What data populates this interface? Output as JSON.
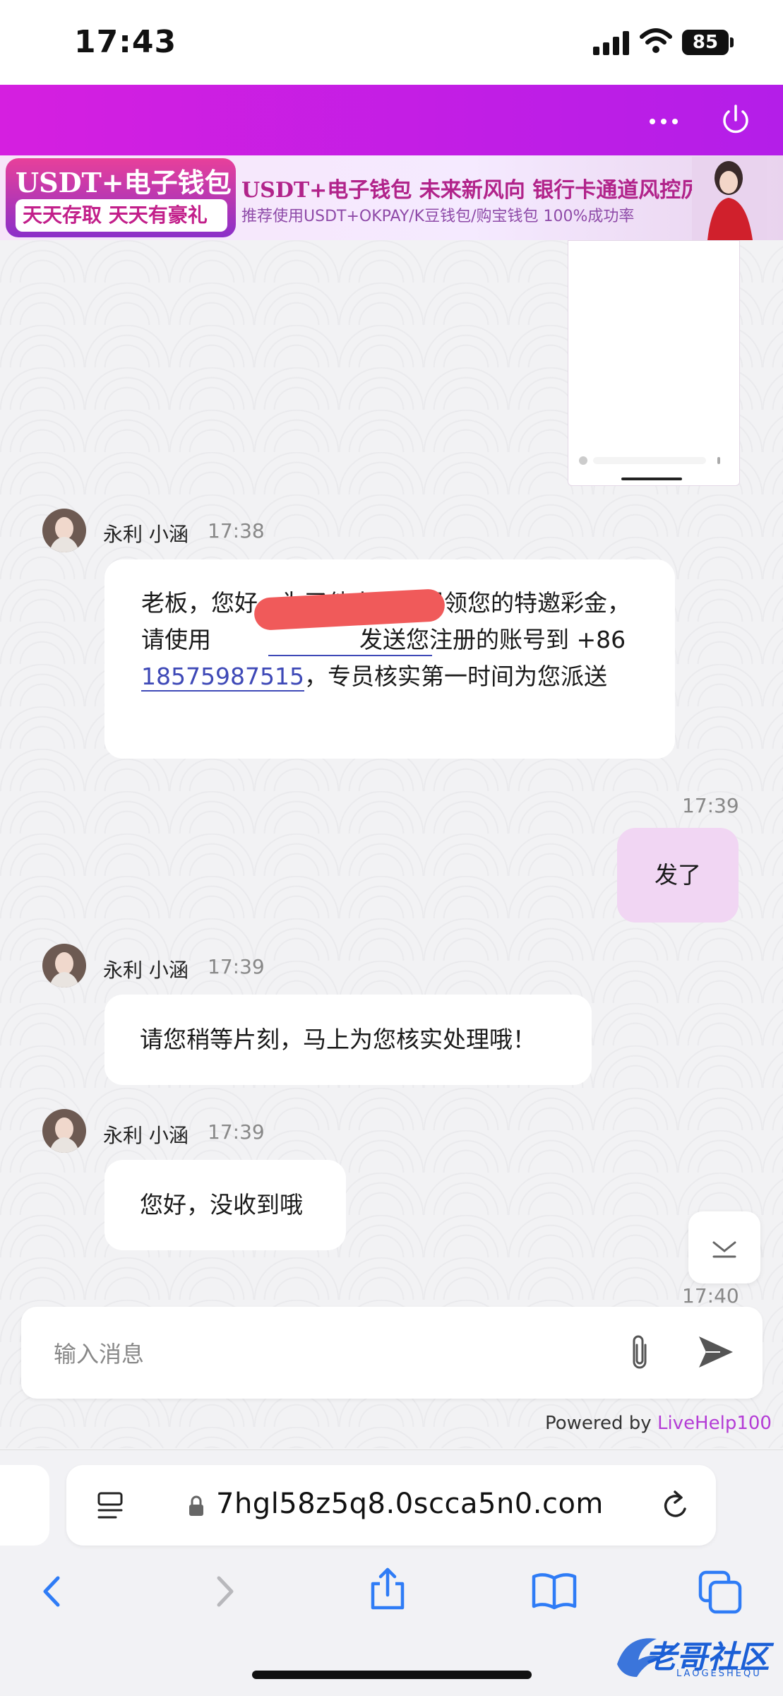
{
  "status_bar": {
    "time": "17:43",
    "battery": "85"
  },
  "header": {
    "more_icon": "ellipsis-icon",
    "power_icon": "power-icon"
  },
  "banner": {
    "left_title": "USDT+电子钱包",
    "left_subtitle": "天天存取 天天有豪礼",
    "right_title": "USDT+电子钱包  未来新风向  银行卡通道风控厉害",
    "right_subtitle": "推荐使用USDT+OKPAY/K豆钱包/购宝钱包   100%成功率"
  },
  "messages": [
    {
      "sender": "永利 小涵",
      "time": "17:38",
      "text_part1": "老板，您好，为了他人避免冒领您的特邀彩金，请使用",
      "text_part2": "发送您注册的账号到 +86 ",
      "phone": "18575987515",
      "text_part3": "，专员核实第一时间为您派送"
    },
    {
      "mine": true,
      "time": "17:39",
      "text": "发了"
    },
    {
      "sender": "永利 小涵",
      "time": "17:39",
      "text": "请您稍等片刻，马上为您核实处理哦！"
    },
    {
      "sender": "永利 小涵",
      "time": "17:39",
      "text": "您好，没收到哦"
    },
    {
      "time": "17:40"
    }
  ],
  "composer": {
    "placeholder": "输入消息",
    "attach_icon": "paperclip-icon",
    "send_icon": "send-icon"
  },
  "footer": {
    "powered_by": "Powered by ",
    "brand": "LiveHelp100"
  },
  "browser": {
    "url": "7hgl58z5q8.0scca5n0.com"
  },
  "watermark": {
    "title": "老哥社区",
    "subtitle": "LAOGESHEQU"
  },
  "colors": {
    "header": "#c81fe4",
    "mine_bubble": "#f1d6f3",
    "link": "#3e49b7",
    "ios_blue": "#2f7cf6"
  }
}
